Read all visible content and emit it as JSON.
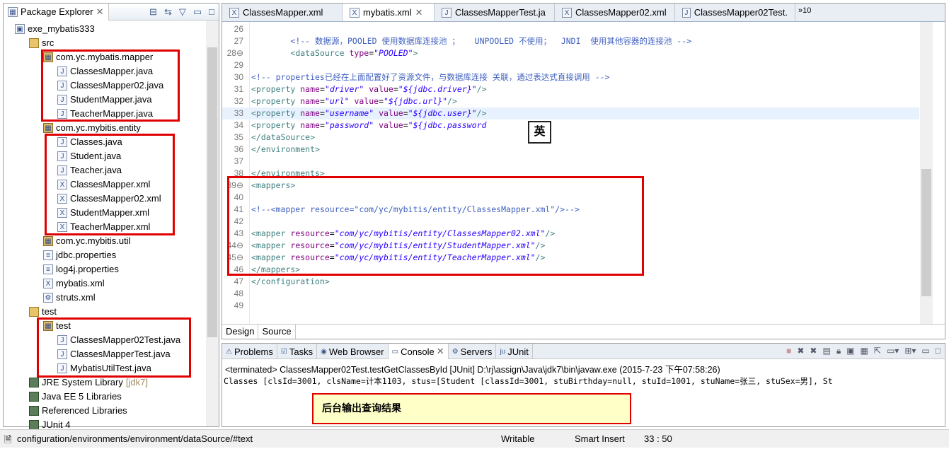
{
  "explorer": {
    "title": "Package Explorer",
    "items": [
      {
        "label": "exe_mybatis333",
        "icon": "project-icon",
        "indent": 0
      },
      {
        "label": "src",
        "icon": "folder-icon",
        "indent": 1
      },
      {
        "label": "com.yc.mybatis.mapper",
        "icon": "package-icon",
        "indent": 2
      },
      {
        "label": "ClassesMapper.java",
        "icon": "java-file-icon",
        "indent": 3
      },
      {
        "label": "ClassesMapper02.java",
        "icon": "java-file-icon",
        "indent": 3
      },
      {
        "label": "StudentMapper.java",
        "icon": "java-file-icon",
        "indent": 3
      },
      {
        "label": "TeacherMapper.java",
        "icon": "java-file-icon",
        "indent": 3
      },
      {
        "label": "com.yc.mybitis.entity",
        "icon": "package-icon",
        "indent": 2
      },
      {
        "label": "Classes.java",
        "icon": "java-file-icon",
        "indent": 3
      },
      {
        "label": "Student.java",
        "icon": "java-file-icon",
        "indent": 3
      },
      {
        "label": "Teacher.java",
        "icon": "java-file-icon",
        "indent": 3
      },
      {
        "label": "ClassesMapper.xml",
        "icon": "xml-file-icon",
        "indent": 3
      },
      {
        "label": "ClassesMapper02.xml",
        "icon": "xml-file-icon",
        "indent": 3
      },
      {
        "label": "StudentMapper.xml",
        "icon": "xml-file-icon",
        "indent": 3
      },
      {
        "label": "TeacherMapper.xml",
        "icon": "xml-file-icon",
        "indent": 3
      },
      {
        "label": "com.yc.mybitis.util",
        "icon": "package-icon",
        "indent": 2
      },
      {
        "label": "jdbc.properties",
        "icon": "properties-file-icon",
        "indent": 2
      },
      {
        "label": "log4j.properties",
        "icon": "properties-file-icon",
        "indent": 2
      },
      {
        "label": "mybatis.xml",
        "icon": "xml-file-icon",
        "indent": 2
      },
      {
        "label": "struts.xml",
        "icon": "struts-file-icon",
        "indent": 2
      },
      {
        "label": "test",
        "icon": "folder-icon",
        "indent": 1
      },
      {
        "label": "test",
        "icon": "package-icon",
        "indent": 2
      },
      {
        "label": "ClassesMapper02Test.java",
        "icon": "java-file-icon",
        "indent": 3
      },
      {
        "label": "ClassesMapperTest.java",
        "icon": "java-file-icon",
        "indent": 3
      },
      {
        "label": "MybatisUtilTest.java",
        "icon": "java-file-icon",
        "indent": 3
      },
      {
        "label": "JRE System Library",
        "suffix": "[jdk7]",
        "icon": "library-icon",
        "indent": 1
      },
      {
        "label": "Java EE 5 Libraries",
        "icon": "library-icon",
        "indent": 1
      },
      {
        "label": "Referenced Libraries",
        "icon": "library-icon",
        "indent": 1
      },
      {
        "label": "JUnit 4",
        "icon": "library-icon",
        "indent": 1
      }
    ]
  },
  "editor": {
    "tabs": [
      {
        "label": "ClassesMapper.xml",
        "icon": "X"
      },
      {
        "label": "mybatis.xml",
        "icon": "X",
        "active": true
      },
      {
        "label": "ClassesMapperTest.ja",
        "icon": "J"
      },
      {
        "label": "ClassesMapper02.xml",
        "icon": "X"
      },
      {
        "label": "ClassesMapper02Test.",
        "icon": "J"
      }
    ],
    "overflow": "»10",
    "lines": [
      {
        "n": "26",
        "s": []
      },
      {
        "n": "27",
        "s": [
          [
            "t",
            "        "
          ],
          [
            "cmt",
            "<!-- 数据源，POOLED 使用数据库连接池 ；   UNPOOLED 不使用；  JNDI  使用其他容器的连接池 -->"
          ]
        ]
      },
      {
        "n": "28⊖",
        "s": [
          [
            "t",
            "        "
          ],
          [
            "tag",
            "<dataSource "
          ],
          [
            "attr",
            "type"
          ],
          [
            "t",
            "="
          ],
          [
            "val",
            "\"POOLED\""
          ],
          [
            "tag",
            ">"
          ]
        ]
      },
      {
        "n": "29",
        "s": []
      },
      {
        "n": "30",
        "s": [
          [
            "cmt",
            "<!-- properties已经在上面配置好了资源文件，与数据库连接 关联，通过表达式直接调用 -->"
          ]
        ]
      },
      {
        "n": "31",
        "s": [
          [
            "tag",
            "<property "
          ],
          [
            "attr",
            "name"
          ],
          [
            "t",
            "="
          ],
          [
            "val",
            "\"driver\""
          ],
          [
            "t",
            " "
          ],
          [
            "attr",
            "value"
          ],
          [
            "t",
            "="
          ],
          [
            "val",
            "\"${jdbc.driver}\""
          ],
          [
            "tag",
            "/>"
          ]
        ]
      },
      {
        "n": "32",
        "s": [
          [
            "tag",
            "<property "
          ],
          [
            "attr",
            "name"
          ],
          [
            "t",
            "="
          ],
          [
            "val",
            "\"url\""
          ],
          [
            "t",
            " "
          ],
          [
            "attr",
            "value"
          ],
          [
            "t",
            "="
          ],
          [
            "val",
            "\"${jdbc.url}\""
          ],
          [
            "tag",
            "/>"
          ]
        ]
      },
      {
        "n": "33",
        "s": [
          [
            "tag",
            "<property "
          ],
          [
            "attr",
            "name"
          ],
          [
            "t",
            "="
          ],
          [
            "val",
            "\"username\""
          ],
          [
            "t",
            " "
          ],
          [
            "attr",
            "value"
          ],
          [
            "t",
            "="
          ],
          [
            "val",
            "\"${jdbc.user}\""
          ],
          [
            "tag",
            "/>"
          ]
        ]
      },
      {
        "n": "34",
        "s": [
          [
            "tag",
            "<property "
          ],
          [
            "attr",
            "name"
          ],
          [
            "t",
            "="
          ],
          [
            "val",
            "\"password\""
          ],
          [
            "t",
            " "
          ],
          [
            "attr",
            "value"
          ],
          [
            "t",
            "="
          ],
          [
            "val",
            "\"${jdbc.password"
          ]
        ]
      },
      {
        "n": "35",
        "s": [
          [
            "tag",
            "</dataSource>"
          ]
        ]
      },
      {
        "n": "36",
        "s": [
          [
            "tag",
            "</environment>"
          ]
        ]
      },
      {
        "n": "37",
        "s": []
      },
      {
        "n": "38",
        "s": [
          [
            "tag",
            "</environments>"
          ]
        ]
      },
      {
        "n": "39⊖",
        "s": [
          [
            "tag",
            "<mappers>"
          ]
        ]
      },
      {
        "n": "40",
        "s": []
      },
      {
        "n": "41",
        "s": [
          [
            "cmt",
            "<!--<mapper resource=\"com/yc/mybitis/entity/ClassesMapper.xml\"/>-->"
          ]
        ]
      },
      {
        "n": "42",
        "s": []
      },
      {
        "n": "43",
        "s": [
          [
            "tag",
            "<mapper "
          ],
          [
            "attr",
            "resource"
          ],
          [
            "t",
            "="
          ],
          [
            "val",
            "\"com/yc/mybitis/entity/ClassesMapper02.xml\""
          ],
          [
            "tag",
            "/>"
          ]
        ]
      },
      {
        "n": "44⊖",
        "s": [
          [
            "tag",
            "<mapper "
          ],
          [
            "attr",
            "resource"
          ],
          [
            "t",
            "="
          ],
          [
            "val",
            "\"com/yc/mybitis/entity/StudentMapper.xml\""
          ],
          [
            "tag",
            "/>"
          ]
        ]
      },
      {
        "n": "45⊖",
        "s": [
          [
            "tag",
            "<mapper "
          ],
          [
            "attr",
            "resource"
          ],
          [
            "t",
            "="
          ],
          [
            "val",
            "\"com/yc/mybitis/entity/TeacherMapper.xml\""
          ],
          [
            "tag",
            "/>"
          ]
        ]
      },
      {
        "n": "46",
        "s": [
          [
            "tag",
            "</mappers>"
          ]
        ]
      },
      {
        "n": "47",
        "s": [
          [
            "tag",
            "</configuration>"
          ]
        ]
      },
      {
        "n": "48",
        "s": []
      },
      {
        "n": "49",
        "s": []
      }
    ],
    "ime_indicator": "英",
    "bottom_tabs": [
      "Design",
      "Source"
    ]
  },
  "console": {
    "tabs": [
      "Problems",
      "Tasks",
      "Web Browser",
      "Console",
      "Servers",
      "JUnit"
    ],
    "header": "<terminated> ClassesMapper02Test.testGetClassesById [JUnit] D:\\rj\\assign\\Java\\jdk7\\bin\\javaw.exe (2015-7-23 下午07:58:26)",
    "output": "Classes [clsId=3001, clsName=计本1103, stus=[Student [classId=3001, stuBirthday=null, stuId=1001, stuName=张三, stuSex=男], St",
    "annotation": "后台输出查询结果"
  },
  "status": {
    "path": "configuration/environments/environment/dataSource/#text",
    "mode": "Writable",
    "insert": "Smart Insert",
    "position": "33 : 50"
  },
  "colors": {
    "highlight": "#e00000",
    "annotation_bg": "#ffffc8",
    "current_line": "#e8f2fe"
  }
}
